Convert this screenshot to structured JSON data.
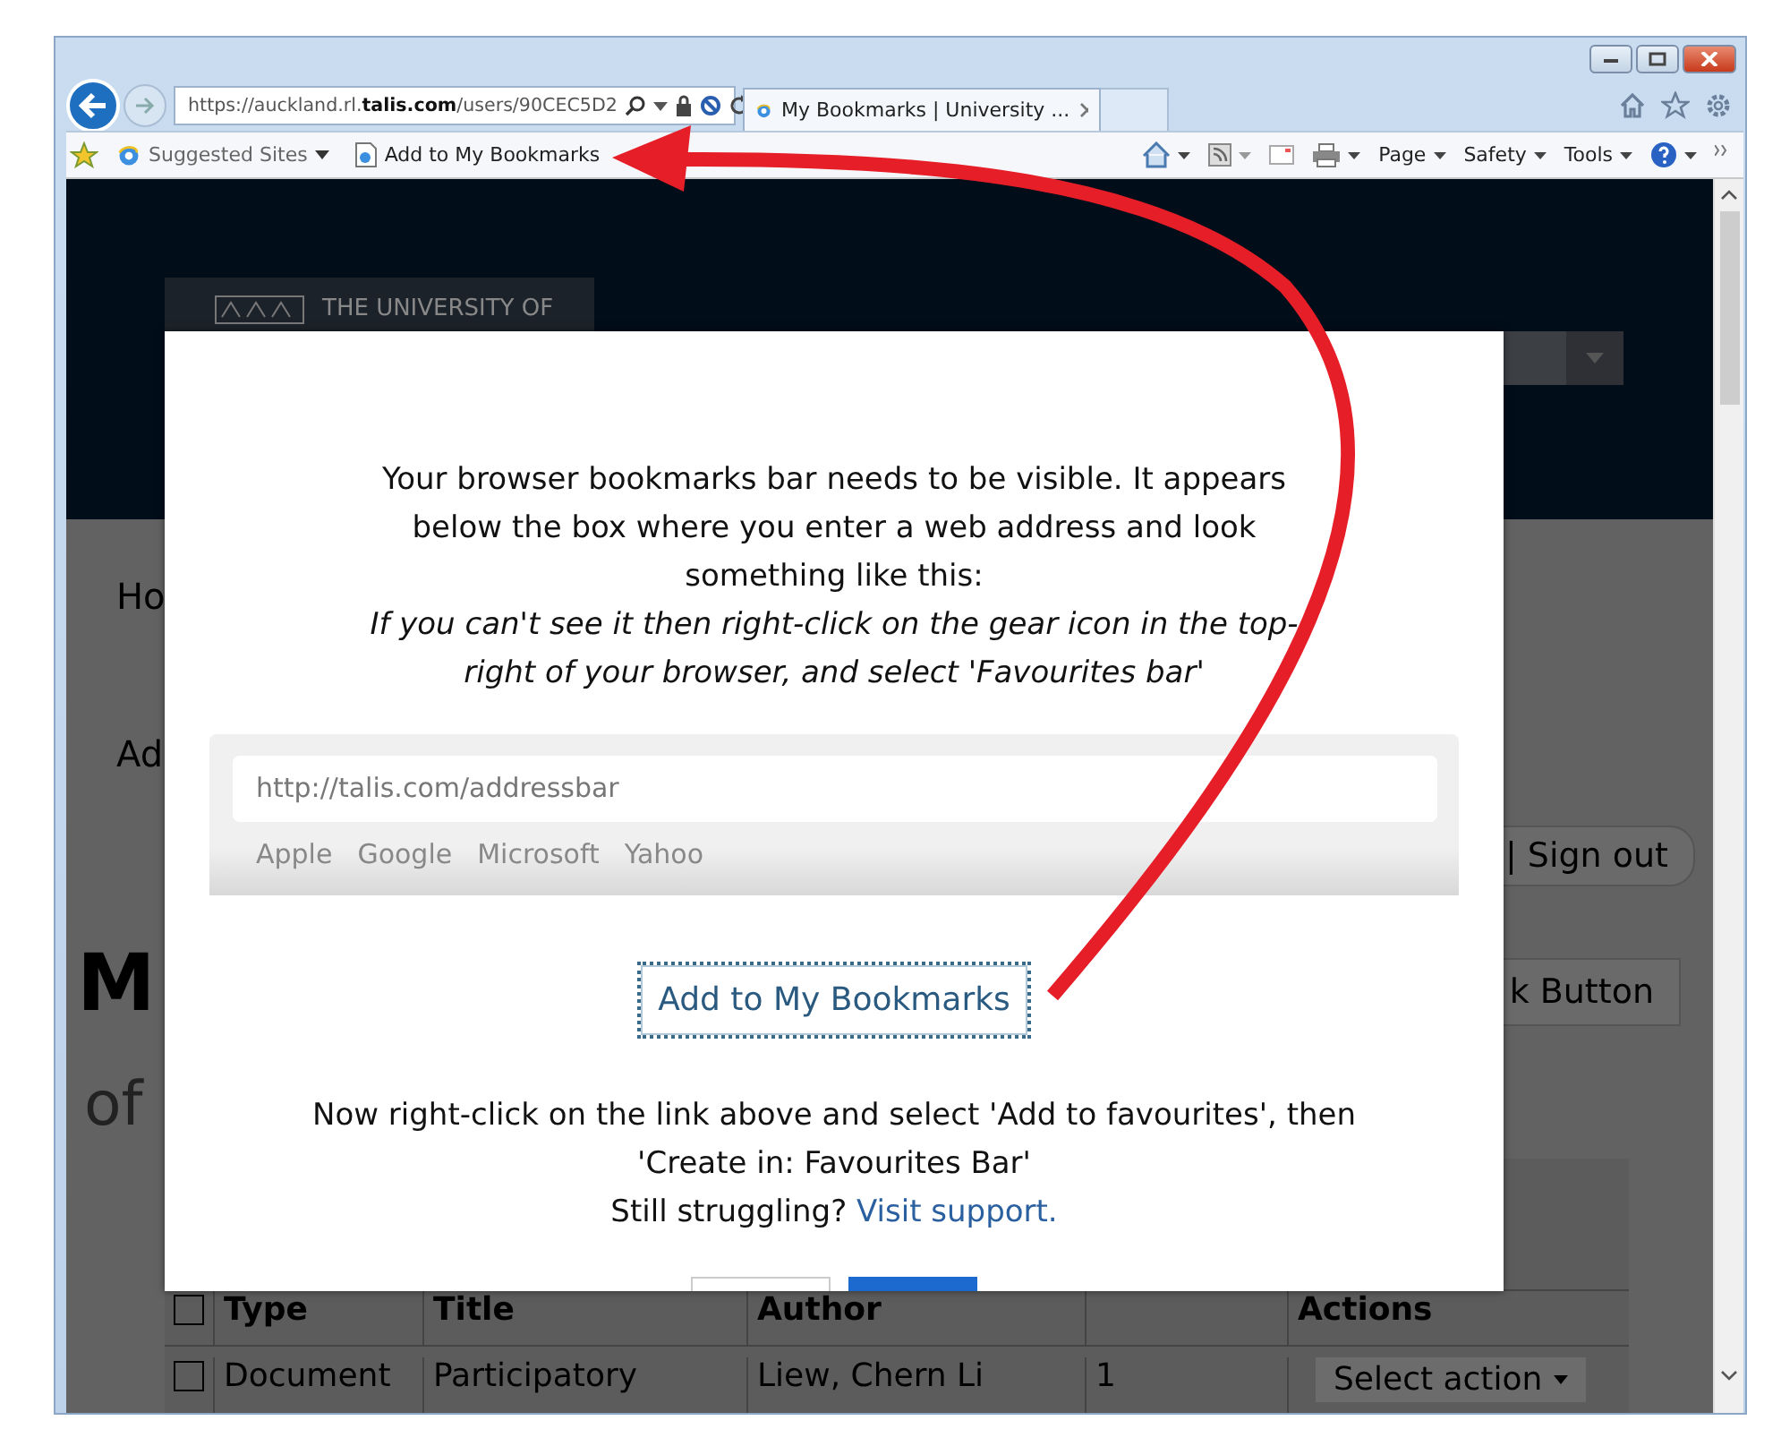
{
  "browser": {
    "address": "https://auckland.rl.**talis.com**/users/90CEC5D2",
    "tabs": [
      {
        "title": "My Bookmarks | University ...",
        "selected": true
      }
    ],
    "favorites": [
      {
        "kind": "menu",
        "label": "Suggested Sites"
      },
      {
        "kind": "page",
        "label": "Add to My Bookmarks"
      }
    ],
    "commands": [
      "Page",
      "Safety",
      "Tools"
    ]
  },
  "page": {
    "logo_text": "THE UNIVERSITY OF",
    "nav": [
      "Ho",
      "Ad"
    ],
    "account_link": "| Sign out",
    "heading": "M",
    "subheading": "of",
    "toolbar_button": "k Button",
    "table": {
      "select_all_checked": false,
      "columns": [
        {
          "label": "Type"
        },
        {
          "label": "Title"
        },
        {
          "label": "Author"
        },
        {},
        {
          "label": "Actions"
        }
      ],
      "rows": [
        {
          "checked": false,
          "type": "Document",
          "title": "Participatory",
          "author": "Liew, Chern Li",
          "column_4": "1",
          "action": "Select action"
        }
      ]
    }
  },
  "dialog": {
    "intro": "Your browser bookmarks bar needs to be visible. It appears below the box where you enter a web address and look something like this:",
    "hint": "If you can't see it then right-click on the gear icon in the top-right of your browser, and select 'Favourites bar'",
    "example": {
      "address": "http://talis.com/addressbar",
      "links": [
        "Apple",
        "Google",
        "Microsoft",
        "Yahoo"
      ]
    },
    "bookmark_link": "Add to My Bookmarks",
    "instructions": "Now right-click on the link above and select 'Add to favourites', then 'Create in: Favourites Bar'",
    "help_text": "Still struggling?",
    "help_link": "Visit support."
  }
}
